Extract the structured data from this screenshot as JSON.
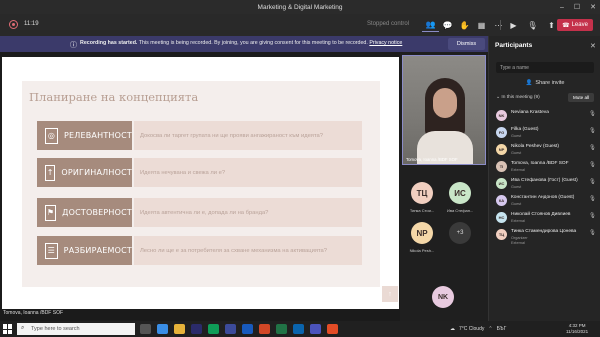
{
  "window": {
    "title": "Marketing & Digital Marketing"
  },
  "toolbar": {
    "timer": "11:19",
    "recording_status": "Stopped control",
    "leave_label": "Leave"
  },
  "banner": {
    "bold": "Recording has started.",
    "text": " This meeting is being recorded. By joining, you are giving consent for this meeting to be recorded. ",
    "link": "Privacy notice",
    "dismiss_label": "Dismiss"
  },
  "slide": {
    "title": "Планиране на концепцията",
    "rows": [
      {
        "label": "РЕЛЕВАНТНОСТ",
        "icon": "target-icon",
        "glyph": "◎",
        "question": "Докосва ли таргет групата ни ще прояви ангажираност към идеята?"
      },
      {
        "label": "ОРИГИНАЛНОСТ",
        "icon": "upload-icon",
        "glyph": "↑",
        "question": "Идеята нечувана и свежа ли е?"
      },
      {
        "label": "ДОСТОВЕРНОСТ",
        "icon": "flag-icon",
        "glyph": "⚑",
        "question": "Идеята автентична ли е, допада ли на бранда?"
      },
      {
        "label": "РАЗБИРАЕМОСТ",
        "icon": "clipboard-icon",
        "glyph": "☰",
        "question": "Лесно ли ще е за потребителя за схване механизма на активацията?"
      }
    ],
    "page_button": "↑"
  },
  "presenter_caption": "Tomova, Ioanna /BDF SOF",
  "video": {
    "caption": "Tomova, Ioanna /BDF SOF"
  },
  "tiles": [
    {
      "initials": "ТЦ",
      "name": "Тинка Стои...",
      "color": "#f1cfc0"
    },
    {
      "initials": "ИС",
      "name": "Ива Стефан...",
      "color": "#c9e6c8"
    },
    {
      "initials": "NP",
      "name": "Nikola Pesh...",
      "color": "#f4d7a8"
    },
    {
      "initials": "+3",
      "name": "",
      "color": "#3a3a3a"
    }
  ],
  "extra_tile": {
    "initials": "NK"
  },
  "participants": {
    "title": "Participants",
    "search_placeholder": "Type a name",
    "share_invite": "Share invite",
    "in_meeting": "In this meeting (9)",
    "mute_all": "Mute all",
    "list": [
      {
        "initials": "NK",
        "name": "Neviana Krasteva",
        "role": "",
        "color": "#e8cadf"
      },
      {
        "initials": "FG",
        "name": "Filka (Guest)",
        "role": "Guest",
        "color": "#c8d7f0"
      },
      {
        "initials": "NP",
        "name": "Nikola Peshev (Guest)",
        "role": "Guest",
        "color": "#f4d7a8"
      },
      {
        "initials": "TI",
        "name": "Tomova, Ioanna /BDF SOF",
        "role": "External",
        "color": "#d9c2b5"
      },
      {
        "initials": "ИС",
        "name": "Ива Стефанова (Гост) (Guest)",
        "role": "Guest",
        "color": "#c9e6c8"
      },
      {
        "initials": "КА",
        "name": "Константин Андонов (Guest)",
        "role": "Guest",
        "color": "#d6c8ee"
      },
      {
        "initials": "НС",
        "name": "Николай Стоянов Дивлиев",
        "role": "External",
        "color": "#c6e4ef"
      },
      {
        "initials": "ТЦ",
        "name": "Тинка Стамендирова Цонева",
        "role": "Organizer\nExternal",
        "color": "#f1cfc0"
      }
    ]
  },
  "taskbar": {
    "search_placeholder": "Type here to search",
    "weather": "7°C  Cloudy",
    "lang": "БЪГ",
    "time": "4:32 PM",
    "date": "11/16/2021"
  }
}
